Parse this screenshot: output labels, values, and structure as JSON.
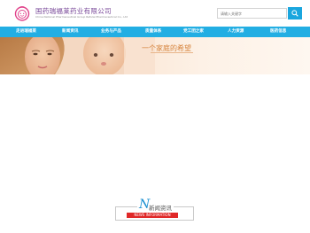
{
  "header": {
    "company_cn": "国药瑞福莱药业有限公司",
    "company_en": "China National Pharmaceutical Group Refulai Pharmaceutical Co., Ltd",
    "search_placeholder": "请输入关键字"
  },
  "nav": {
    "items": [
      "走进瑞福莱",
      "新闻资讯",
      "业务与产品",
      "质量体系",
      "党工团之家",
      "人力资源",
      "医药信息"
    ]
  },
  "banner": {
    "slogan": "一个家庭的希望"
  },
  "news": {
    "title": "新闻资讯",
    "badge": "NEWS INFORMATION"
  },
  "colors": {
    "nav_bg": "#22aee3",
    "search_btn": "#1aa6de",
    "badge_red": "#e02828",
    "logo_text": "#7a4a9a",
    "slogan": "#d5823a"
  },
  "icons": [
    "logo-icon",
    "search-icon"
  ]
}
